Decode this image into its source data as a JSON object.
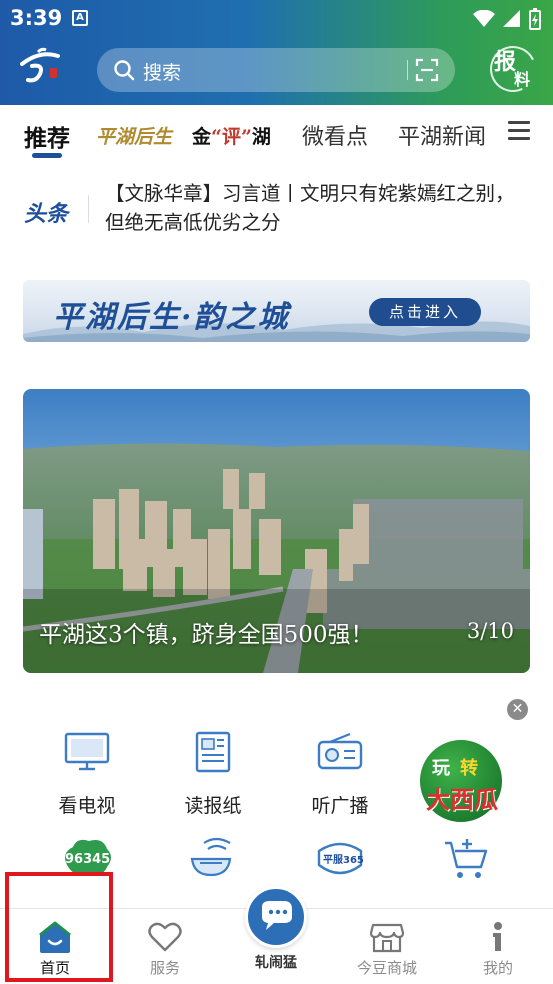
{
  "status_bar": {
    "time": "3:39",
    "notification_icon": "A"
  },
  "header": {
    "search_placeholder": "搜索",
    "report_button": {
      "char1": "报",
      "char2": "料"
    }
  },
  "tabs": [
    {
      "label": "推荐",
      "active": true
    },
    {
      "label": "平湖后生"
    },
    {
      "label_parts": [
        "金",
        "“评”",
        "湖"
      ]
    },
    {
      "label": "微看点"
    },
    {
      "label": "平湖新闻"
    }
  ],
  "headline": {
    "tag": "头条",
    "text": "【文脉华章】习言道丨文明只有姹紫嫣红之别，但绝无高低优劣之分"
  },
  "banner": {
    "title": "平湖后生·韵之城",
    "button": "点击进入"
  },
  "hero": {
    "caption": "平湖这3个镇，跻身全国500强！",
    "counter": "3/10"
  },
  "services": [
    {
      "label": "看电视",
      "icon": "tv-icon"
    },
    {
      "label": "读报纸",
      "icon": "newspaper-icon"
    },
    {
      "label": "听广播",
      "icon": "radio-icon"
    }
  ],
  "promo": {
    "line1_a": "玩",
    "line1_b": "转",
    "line2": "大西瓜"
  },
  "services_row2": [
    {
      "badge": "96345",
      "icon": "hotline-icon"
    },
    {
      "icon": "smart-meal-icon"
    },
    {
      "badge": "平服365",
      "icon": "pingfu-icon"
    },
    {
      "icon": "cart-icon"
    }
  ],
  "bottom_nav": {
    "items": [
      {
        "label": "首页",
        "active": true
      },
      {
        "label": "服务"
      },
      {
        "label": "轧闹猛",
        "center": true
      },
      {
        "label": "今豆商城"
      },
      {
        "label": "我的"
      }
    ]
  },
  "colors": {
    "brand_blue": "#1d4f9c",
    "header_green": "#3aa647",
    "highlight_red": "#e0171c"
  }
}
